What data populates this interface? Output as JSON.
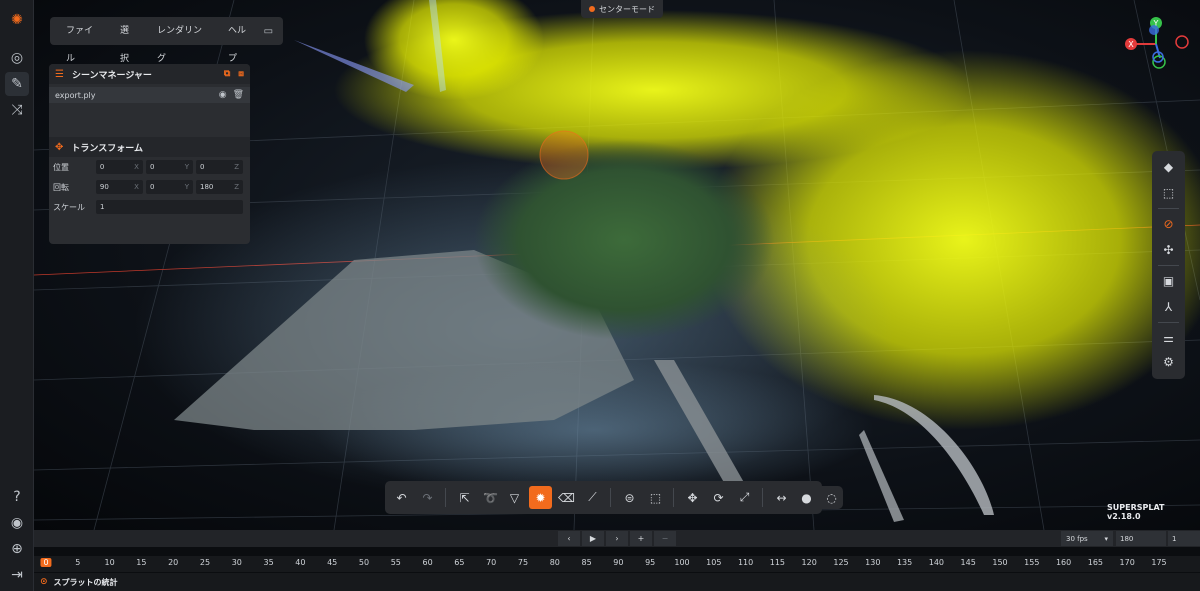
{
  "menu": {
    "items": [
      "ファイル",
      "選択",
      "レンダリング",
      "ヘルプ"
    ]
  },
  "mode_label": "センターモード",
  "scene_manager": {
    "title": "シーンマネージャー",
    "file": "export.ply"
  },
  "transform": {
    "title": "トランスフォーム",
    "position": {
      "label": "位置",
      "x": "0",
      "y": "0",
      "z": "0"
    },
    "rotation": {
      "label": "回転",
      "x": "90",
      "y": "0",
      "z": "180"
    },
    "scale": {
      "label": "スケール",
      "value": "1"
    },
    "axis": {
      "x": "X",
      "y": "Y",
      "z": "Z"
    }
  },
  "gizmo": {
    "x": "X",
    "y": "Y",
    "z": "Z"
  },
  "version": "SUPERSPLAT v2.18.0",
  "timeline": {
    "fps": "30 fps",
    "frames": "180",
    "current": "1",
    "ticks": [
      "0",
      "5",
      "10",
      "15",
      "20",
      "25",
      "30",
      "35",
      "40",
      "45",
      "50",
      "55",
      "60",
      "65",
      "70",
      "75",
      "80",
      "85",
      "90",
      "95",
      "100",
      "105",
      "110",
      "115",
      "120",
      "125",
      "130",
      "135",
      "140",
      "145",
      "150",
      "155",
      "160",
      "165",
      "170",
      "175"
    ]
  },
  "stats": {
    "label": "スプラットの統計"
  },
  "colors": {
    "accent": "#f26b1d",
    "selection": "#e8f000",
    "panel": "#2b2d31"
  }
}
